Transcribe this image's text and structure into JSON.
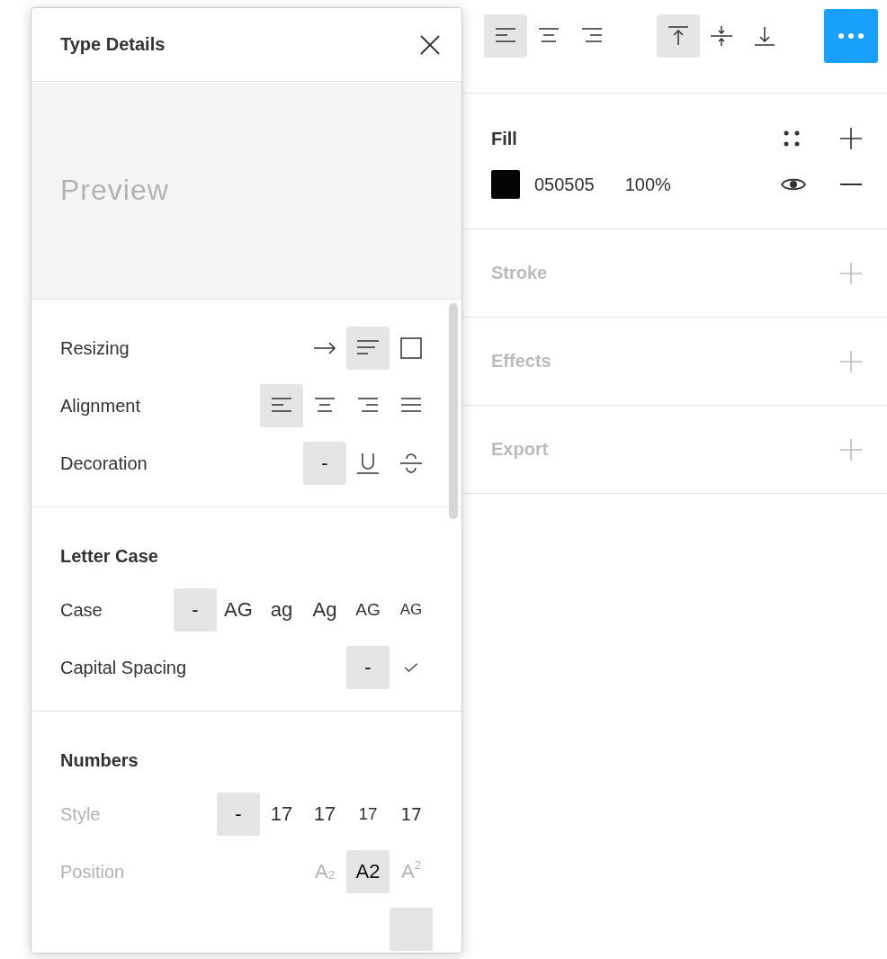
{
  "toolbar": {
    "text_align": [
      {
        "kind": "left",
        "selected": true
      },
      {
        "kind": "center",
        "selected": false
      },
      {
        "kind": "right",
        "selected": false
      }
    ],
    "vertical_align": [
      {
        "kind": "top",
        "selected": true
      },
      {
        "kind": "middle",
        "selected": false
      },
      {
        "kind": "bottom",
        "selected": false
      }
    ]
  },
  "fill": {
    "title": "Fill",
    "items": [
      {
        "color": "#050505",
        "hex": "050505",
        "opacity": "100%"
      }
    ]
  },
  "sections": [
    {
      "title": "Stroke"
    },
    {
      "title": "Effects"
    },
    {
      "title": "Export"
    }
  ],
  "type_details": {
    "title": "Type Details",
    "preview": "Preview",
    "groups": [
      {
        "rows": [
          {
            "label": "Resizing",
            "disabled": false,
            "options": [
              {
                "kind": "arrow",
                "selected": false
              },
              {
                "kind": "lines",
                "selected": true
              },
              {
                "kind": "box",
                "selected": false
              }
            ]
          },
          {
            "label": "Alignment",
            "disabled": false,
            "options": [
              {
                "kind": "left",
                "selected": true
              },
              {
                "kind": "center",
                "selected": false
              },
              {
                "kind": "right",
                "selected": false
              },
              {
                "kind": "justify",
                "selected": false
              }
            ]
          },
          {
            "label": "Decoration",
            "disabled": false,
            "options": [
              {
                "kind": "text",
                "label": "-",
                "selected": true
              },
              {
                "kind": "underline",
                "selected": false
              },
              {
                "kind": "strike",
                "selected": false
              }
            ]
          }
        ]
      },
      {
        "title": "Letter Case",
        "rows": [
          {
            "label": "Case",
            "disabled": false,
            "options": [
              {
                "kind": "text",
                "label": "-",
                "selected": true
              },
              {
                "kind": "text",
                "label": "AG",
                "selected": false
              },
              {
                "kind": "text",
                "label": "ag",
                "selected": false
              },
              {
                "kind": "text",
                "label": "Ag",
                "selected": false
              },
              {
                "kind": "small",
                "label": "AG",
                "selected": false
              },
              {
                "kind": "smaller",
                "label": "AG",
                "selected": false
              }
            ]
          },
          {
            "label": "Capital Spacing",
            "disabled": false,
            "options": [
              {
                "kind": "text",
                "label": "-",
                "selected": true
              },
              {
                "kind": "check",
                "selected": false
              }
            ]
          }
        ]
      },
      {
        "title": "Numbers",
        "rows": [
          {
            "label": "Style",
            "disabled": true,
            "options": [
              {
                "kind": "text",
                "label": "-",
                "selected": true
              },
              {
                "kind": "text",
                "label": "17",
                "selected": false
              },
              {
                "kind": "text",
                "label": "17",
                "selected": false
              },
              {
                "kind": "small",
                "label": "17",
                "selected": false
              },
              {
                "kind": "mono",
                "label": "17",
                "selected": false
              }
            ]
          },
          {
            "label": "Position",
            "disabled": true,
            "options": [
              {
                "kind": "muted",
                "label": "A$_{2}$",
                "selected": false
              },
              {
                "kind": "text",
                "label": "A2",
                "selected": true
              },
              {
                "kind": "muted",
                "label": "A$^{2}$",
                "selected": false
              }
            ]
          },
          {
            "options": [
              {
                "kind": "blank",
                "selected": true
              }
            ]
          }
        ]
      }
    ]
  }
}
